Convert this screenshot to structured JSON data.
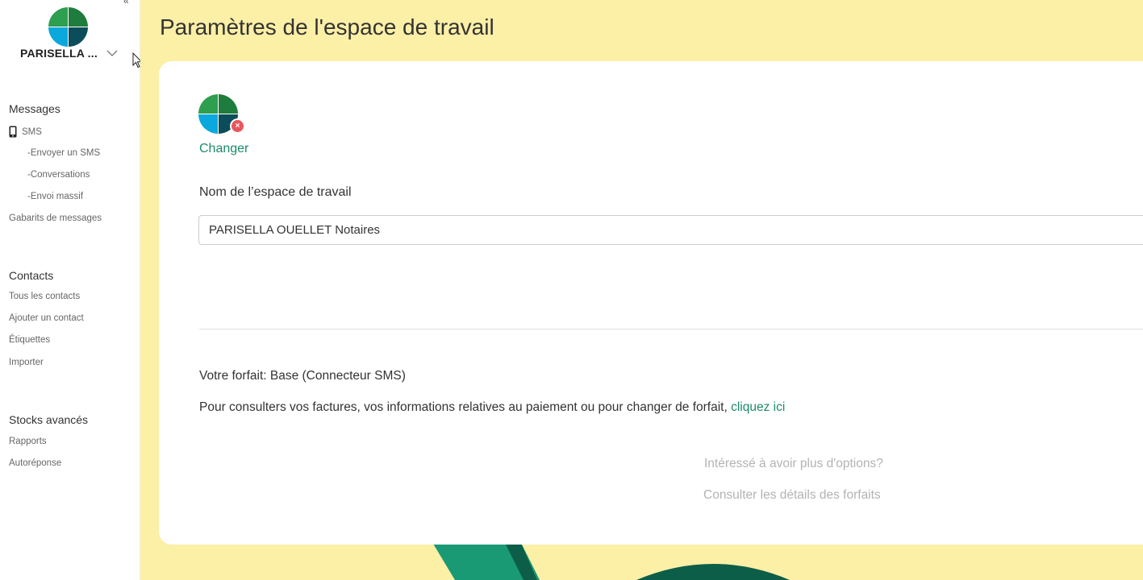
{
  "sidebar": {
    "workspace_name": "PARISELLA ...",
    "sections": [
      {
        "title": "Messages",
        "items": [
          {
            "label": "SMS",
            "icon": "phone-icon"
          },
          {
            "label": "-Envoyer un SMS"
          },
          {
            "label": "-Conversations"
          },
          {
            "label": "-Envoi massif"
          },
          {
            "label": "Gabarits de messages"
          }
        ]
      },
      {
        "title": "Contacts",
        "items": [
          {
            "label": "Tous les contacts"
          },
          {
            "label": "Ajouter un contact"
          },
          {
            "label": "Étiquettes"
          },
          {
            "label": "Importer"
          }
        ]
      },
      {
        "title": "Stocks avancés",
        "items": [
          {
            "label": "Rapports"
          },
          {
            "label": "Autoréponse"
          }
        ]
      }
    ]
  },
  "page": {
    "title": "Paramètres de l'espace de travail"
  },
  "settings": {
    "change_logo_label": "Changer",
    "workspace_name_label": "Nom de l’espace de travail",
    "workspace_name_value": "PARISELLA OUELLET Notaires",
    "plan_text": "Votre forfait: Base (Connecteur SMS)",
    "billing_text": "Pour consulters vos factures, vos informations relatives au paiement ou pour changer de forfait, ",
    "billing_link": "cliquez ici",
    "more_options_text": "Intéressé à avoir plus d'options?",
    "plans_details_link": "Consulter les détails des forfaits"
  },
  "colors": {
    "accent": "#1b8a6b",
    "main_background": "#fcefa6",
    "remove_badge": "#e9555c",
    "logo_green": "#2e9e4f",
    "logo_dark": "#0b4d5a",
    "logo_blue": "#0aa8dd"
  }
}
